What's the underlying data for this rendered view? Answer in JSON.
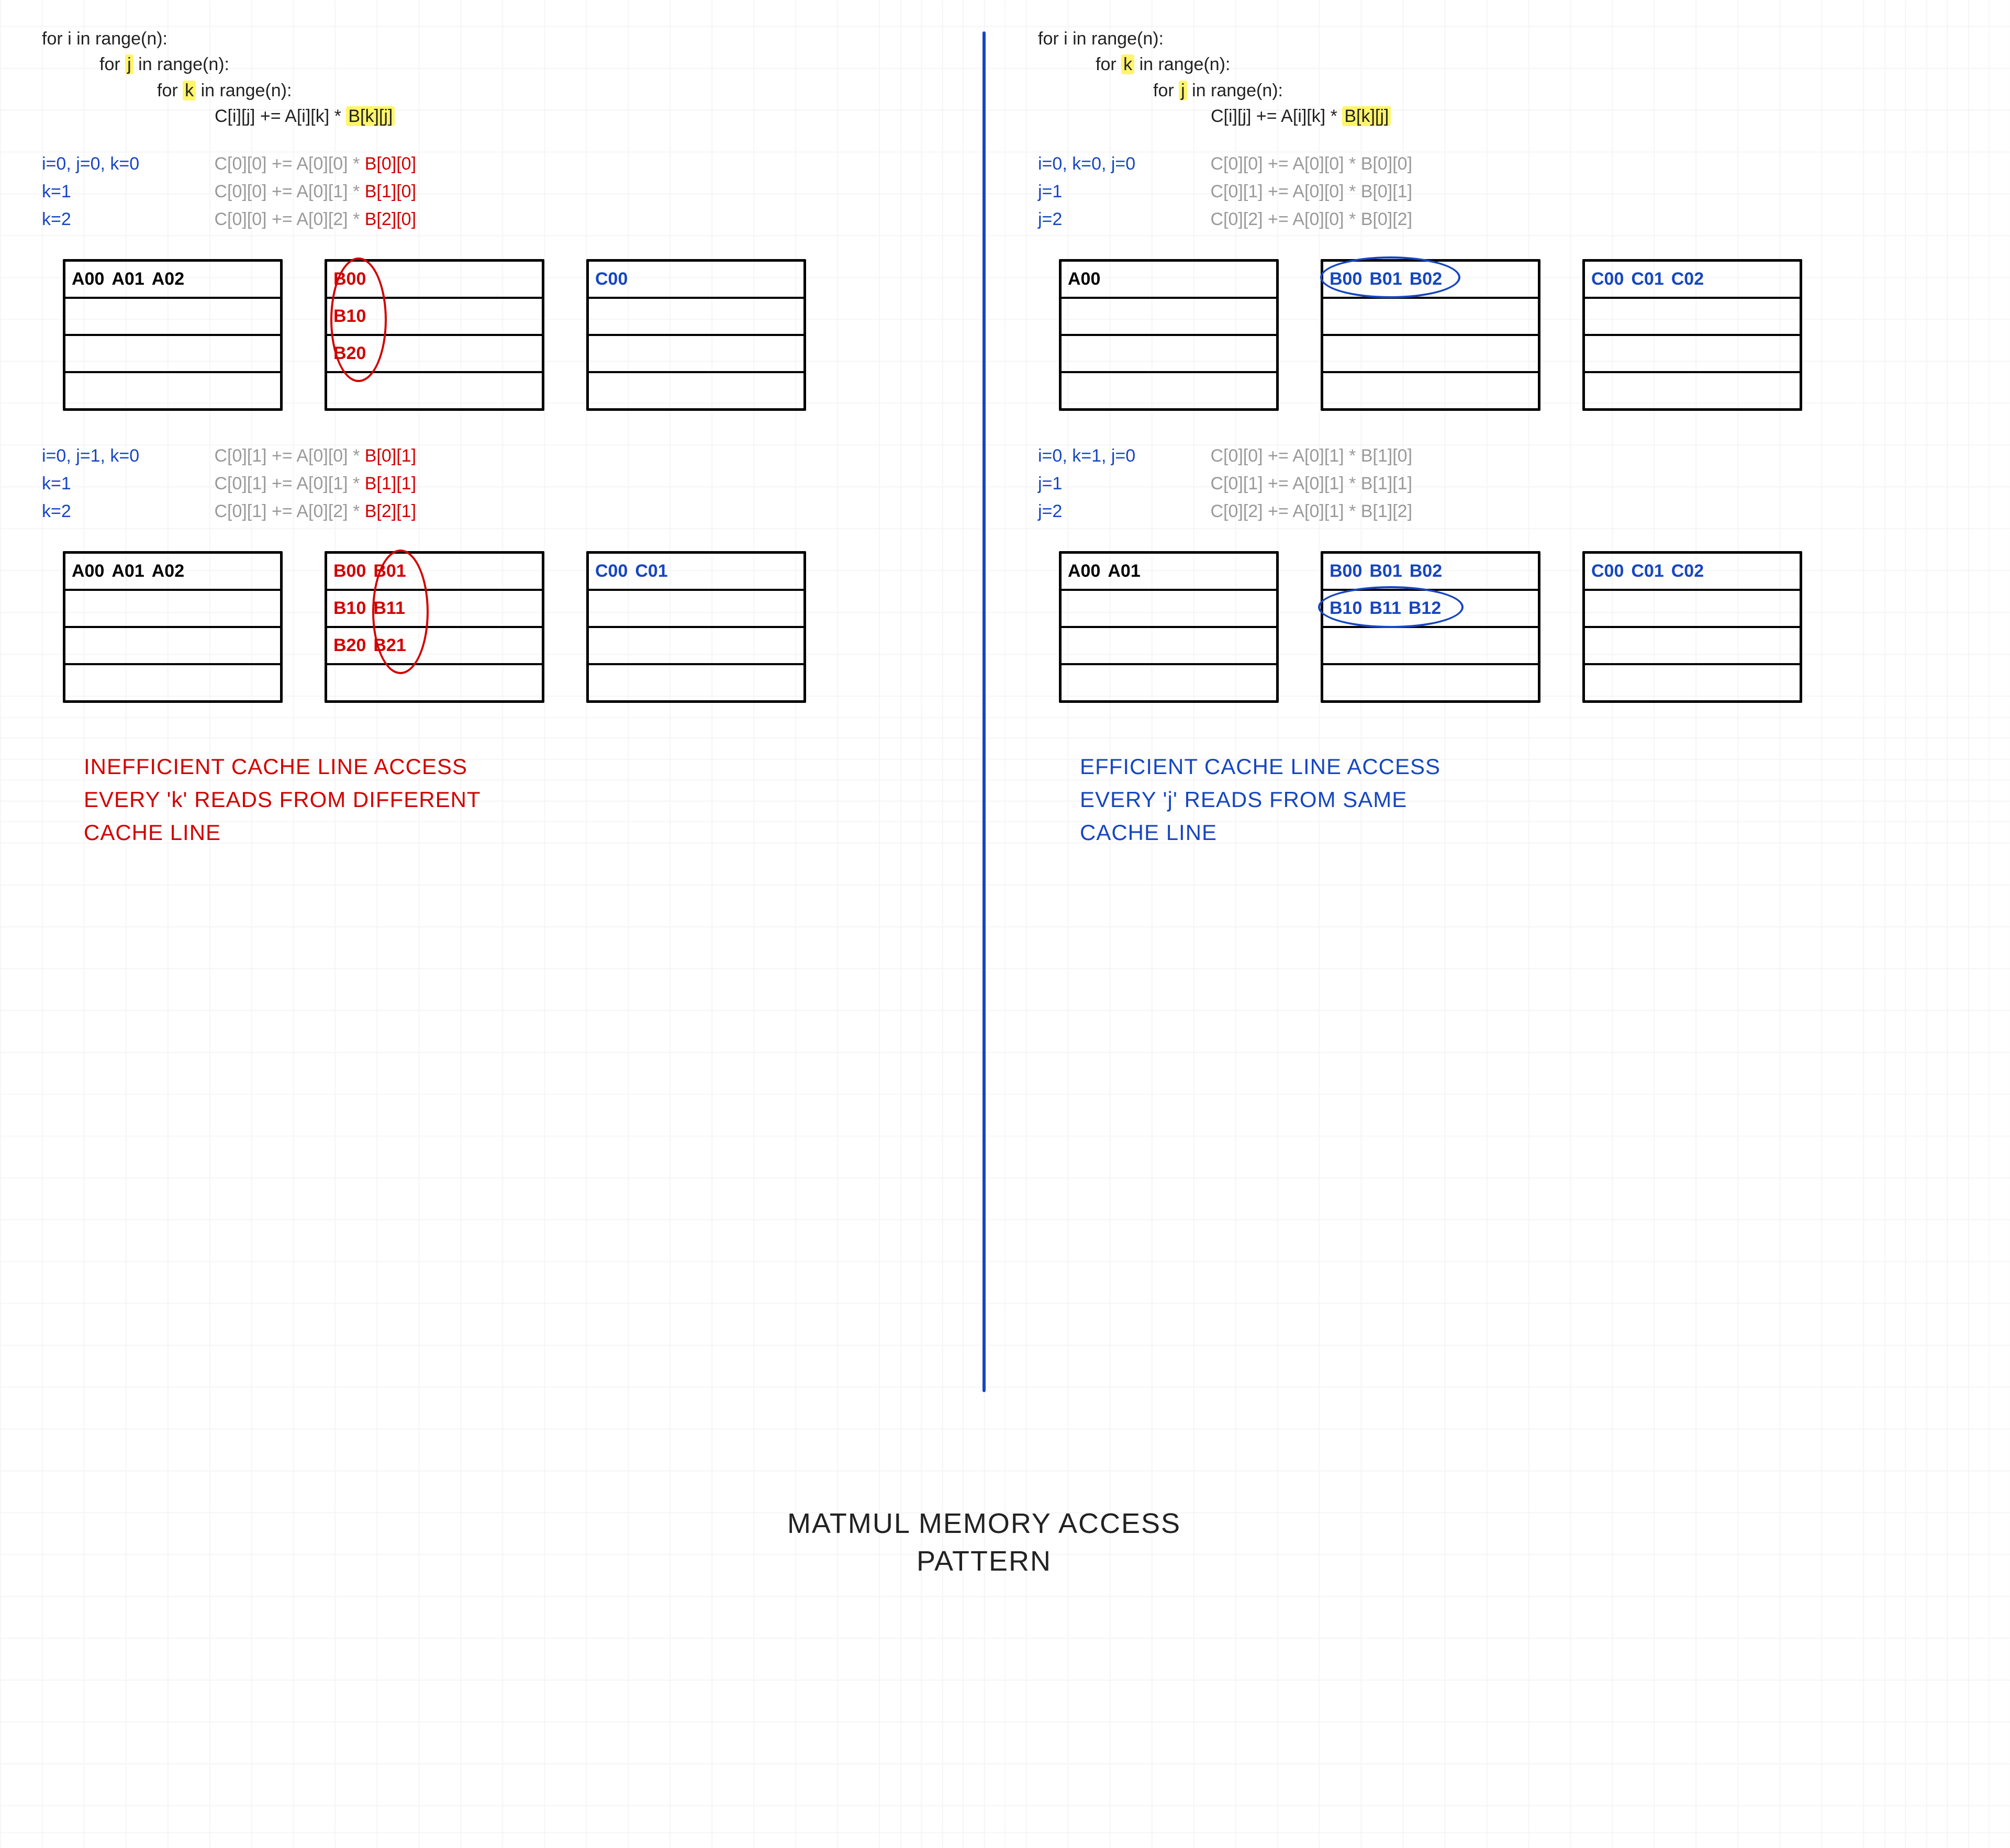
{
  "title_l1": "MATMUL   MEMORY  ACCESS",
  "title_l2": "PATTERN",
  "left": {
    "code": [
      "for i in range(n):",
      "for j in range(n):",
      "for k in range(n):",
      "C[i][j] += A[i][k] * B[k][j]"
    ],
    "hl_vars": [
      "j",
      "k"
    ],
    "hl_term": "B[k][j]",
    "trace1": [
      {
        "iter": "i=0, j=0, k=0",
        "lhs": "C[0][0] += A[0][0] *",
        "b": "B[0][0]"
      },
      {
        "iter": "k=1",
        "lhs": "C[0][0] += A[0][1] *",
        "b": "B[1][0]"
      },
      {
        "iter": "k=2",
        "lhs": "C[0][0] += A[0][2] *",
        "b": "B[2][0]"
      }
    ],
    "mat1": {
      "A": [
        "A00",
        "A01",
        "A02"
      ],
      "B": [
        [
          "B00"
        ],
        [
          "B10"
        ],
        [
          "B20"
        ]
      ],
      "C": [
        "C00"
      ]
    },
    "trace2": [
      {
        "iter": "i=0, j=1, k=0",
        "lhs": "C[0][1] += A[0][0] *",
        "b": "B[0][1]"
      },
      {
        "iter": "k=1",
        "lhs": "C[0][1] += A[0][1] *",
        "b": "B[1][1]"
      },
      {
        "iter": "k=2",
        "lhs": "C[0][1] += A[0][2] *",
        "b": "B[2][1]"
      }
    ],
    "mat2": {
      "A": [
        "A00",
        "A01",
        "A02"
      ],
      "B": [
        [
          "B00",
          "B01"
        ],
        [
          "B10",
          "B11"
        ],
        [
          "B20",
          "B21"
        ]
      ],
      "C": [
        "C00",
        "C01"
      ]
    },
    "concl": [
      "INEFFICIENT  CACHE  LINE  ACCESS",
      "EVERY  'k'  READS  FROM  DIFFERENT",
      "CACHE  LINE"
    ]
  },
  "right": {
    "code": [
      "for i in range(n):",
      "for k in range(n):",
      "for j in range(n):",
      "C[i][j] += A[i][k] * B[k][j]"
    ],
    "hl_vars": [
      "k",
      "j"
    ],
    "hl_term": "B[k][j]",
    "trace1": [
      {
        "iter": "i=0, k=0, j=0",
        "lhs": "C[0][0] += A[0][0] * B[0][0]"
      },
      {
        "iter": "j=1",
        "lhs": "C[0][1] += A[0][0] * B[0][1]"
      },
      {
        "iter": "j=2",
        "lhs": "C[0][2] += A[0][0] * B[0][2]"
      }
    ],
    "mat1": {
      "A": [
        "A00"
      ],
      "B": [
        [
          "B00",
          "B01",
          "B02"
        ]
      ],
      "C": [
        "C00",
        "C01",
        "C02"
      ]
    },
    "trace2": [
      {
        "iter": "i=0, k=1, j=0",
        "lhs": "C[0][0] += A[0][1] * B[1][0]"
      },
      {
        "iter": "j=1",
        "lhs": "C[0][1] += A[0][1] * B[1][1]"
      },
      {
        "iter": "j=2",
        "lhs": "C[0][2] += A[0][1] * B[1][2]"
      }
    ],
    "mat2": {
      "A": [
        "A00",
        "A01"
      ],
      "B": [
        [
          "B00",
          "B01",
          "B02"
        ],
        [
          "B10",
          "B11",
          "B12"
        ]
      ],
      "C": [
        "C00",
        "C01",
        "C02"
      ]
    },
    "concl": [
      "EFFICIENT   CACHE  LINE   ACCESS",
      "EVERY  'j'  READS  FROM  SAME",
      "CACHE  LINE"
    ]
  }
}
